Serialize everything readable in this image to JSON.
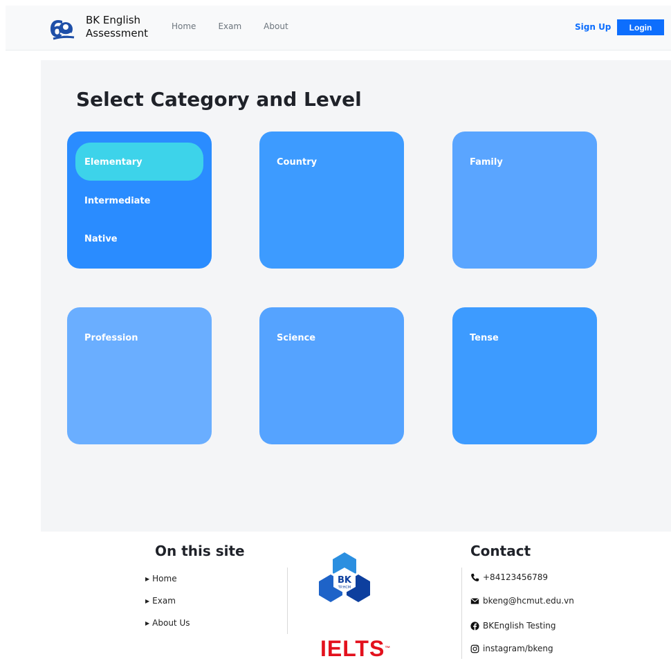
{
  "brand": {
    "name_line1": "BK English",
    "name_line2": "Assessment",
    "logo_text": "6"
  },
  "nav": {
    "links": [
      "Home",
      "Exam",
      "About"
    ],
    "signup": "Sign Up",
    "login": "Login"
  },
  "main": {
    "title": "Select Category and Level",
    "cards": [
      {
        "label": "Country",
        "color": "#3d9bff"
      },
      {
        "label": "Family",
        "color": "#5aa5ff"
      },
      {
        "label": "Profession",
        "color": "#6aaeff"
      },
      {
        "label": "Science",
        "color": "#55a3ff"
      },
      {
        "label": "Tense",
        "color": "#3d9bff"
      }
    ],
    "level_card": {
      "color": "#2a8cff",
      "levels": [
        "Elementary",
        "Intermediate",
        "Native"
      ],
      "selected": "Elementary"
    }
  },
  "footer": {
    "site_heading": "On this site",
    "site_links": [
      "Home",
      "Exam",
      "About Us"
    ],
    "logo_bk_text": "BK",
    "logo_bk_sub": "TP.HCM",
    "logo_ielts": "IELTS",
    "contact_heading": "Contact",
    "contact": {
      "phone": "+84123456789",
      "email": "bkeng@hcmut.edu.vn",
      "facebook": "BKEnglish Testing",
      "instagram": "instagram/bkeng"
    }
  },
  "colors": {
    "primary": "#0d6efd",
    "pill": "#3dd3ea"
  }
}
